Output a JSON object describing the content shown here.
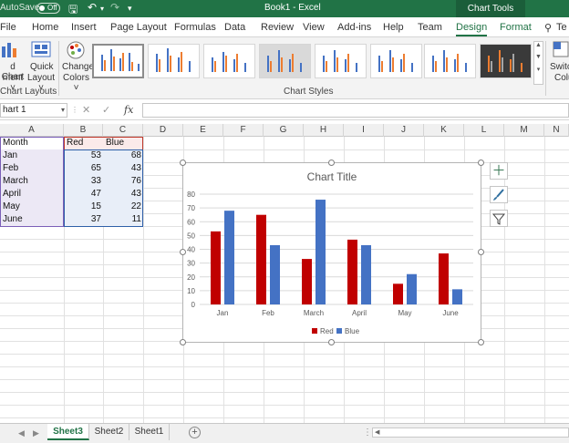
{
  "titlebar": {
    "autosave_label": "AutoSave",
    "autosave_state": "Off",
    "document_title": "Book1  -  Excel",
    "contextual_title": "Chart Tools"
  },
  "tabs": [
    "File",
    "Home",
    "Insert",
    "Page Layout",
    "Formulas",
    "Data",
    "Review",
    "View",
    "Add-ins",
    "Help",
    "Team",
    "Design",
    "Format",
    "Te"
  ],
  "active_tab": "Design",
  "ribbon": {
    "add_chart_label_1": "d Chart",
    "add_chart_label_2": "ment ˅",
    "quick_layout_label_1": "Quick",
    "quick_layout_label_2": "Layout ˅",
    "change_colors_label_1": "Change",
    "change_colors_label_2": "Colors ˅",
    "switch_label_1": "Switc",
    "switch_label_2": "Colu",
    "group_chart_layouts": "Chart Layouts",
    "group_chart_styles": "Chart Styles"
  },
  "formula_bar": {
    "name_box": "hart 1",
    "fx": "fx",
    "value": ""
  },
  "columns": [
    "A",
    "B",
    "C",
    "D",
    "E",
    "F",
    "G",
    "H",
    "I",
    "J",
    "K",
    "L",
    "M",
    "N"
  ],
  "sheet": {
    "headers": [
      "Month",
      "Red",
      "Blue"
    ],
    "rows": [
      [
        "Jan",
        "53",
        "68"
      ],
      [
        "Feb",
        "65",
        "43"
      ],
      [
        "March",
        "33",
        "76"
      ],
      [
        "April",
        "47",
        "43"
      ],
      [
        "May",
        "15",
        "22"
      ],
      [
        "June",
        "37",
        "11"
      ]
    ]
  },
  "chart_data": {
    "type": "bar",
    "title": "Chart Title",
    "categories": [
      "Jan",
      "Feb",
      "March",
      "April",
      "May",
      "June"
    ],
    "series": [
      {
        "name": "Red",
        "values": [
          53,
          65,
          33,
          47,
          15,
          37
        ],
        "color": "#c00000"
      },
      {
        "name": "Blue",
        "values": [
          68,
          43,
          76,
          43,
          22,
          11
        ],
        "color": "#4472c4"
      }
    ],
    "ylim": [
      0,
      80
    ],
    "yticks": [
      "0",
      "10",
      "20",
      "30",
      "40",
      "50",
      "60",
      "70",
      "80"
    ],
    "grid": true,
    "legend": "bottom"
  },
  "chart_side_buttons": {
    "elements_icon": "plus-icon",
    "styles_icon": "brush-icon",
    "filter_icon": "funnel-icon"
  },
  "sheet_tabs": [
    "Sheet3",
    "Sheet2",
    "Sheet1"
  ],
  "active_sheet": "Sheet3",
  "colors": {
    "excel_green": "#217346",
    "red_series": "#c00000",
    "blue_series": "#4472c4"
  }
}
